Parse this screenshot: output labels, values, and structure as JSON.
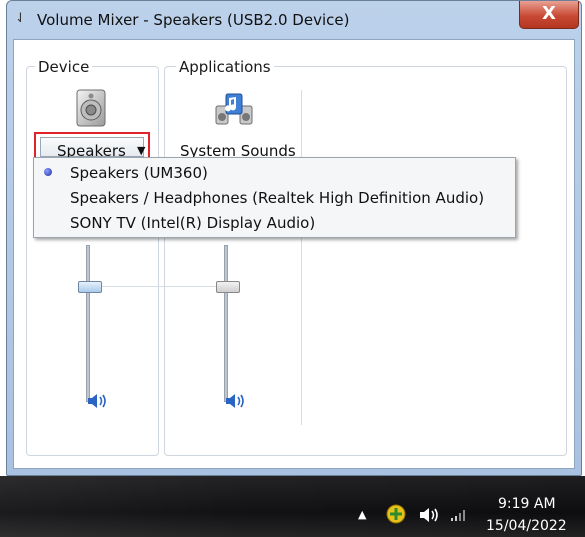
{
  "window": {
    "title": "Volume Mixer - Speakers (USB2.0 Device)",
    "close_label": "X"
  },
  "device": {
    "group_label": "Device",
    "dropdown_value": "Speakers",
    "icon": "speaker-device-icon"
  },
  "applications": {
    "group_label": "Applications",
    "items": [
      {
        "name": "System Sounds",
        "icon": "system-sounds-icon"
      }
    ]
  },
  "menu": {
    "items": [
      {
        "label": "Speakers (UM360)",
        "selected": true
      },
      {
        "label": "Speakers / Headphones (Realtek High Definition Audio)",
        "selected": false
      },
      {
        "label": "SONY TV (Intel(R) Display Audio)",
        "selected": false
      }
    ]
  },
  "taskbar": {
    "time": "9:19 AM",
    "date": "15/04/2022",
    "tray_icons": [
      "show-hidden-icons-arrow",
      "security-shield-icon",
      "volume-icon",
      "network-signal-icon"
    ]
  },
  "colors": {
    "highlight_border": "#e0242c",
    "taskbar": "#141417"
  }
}
